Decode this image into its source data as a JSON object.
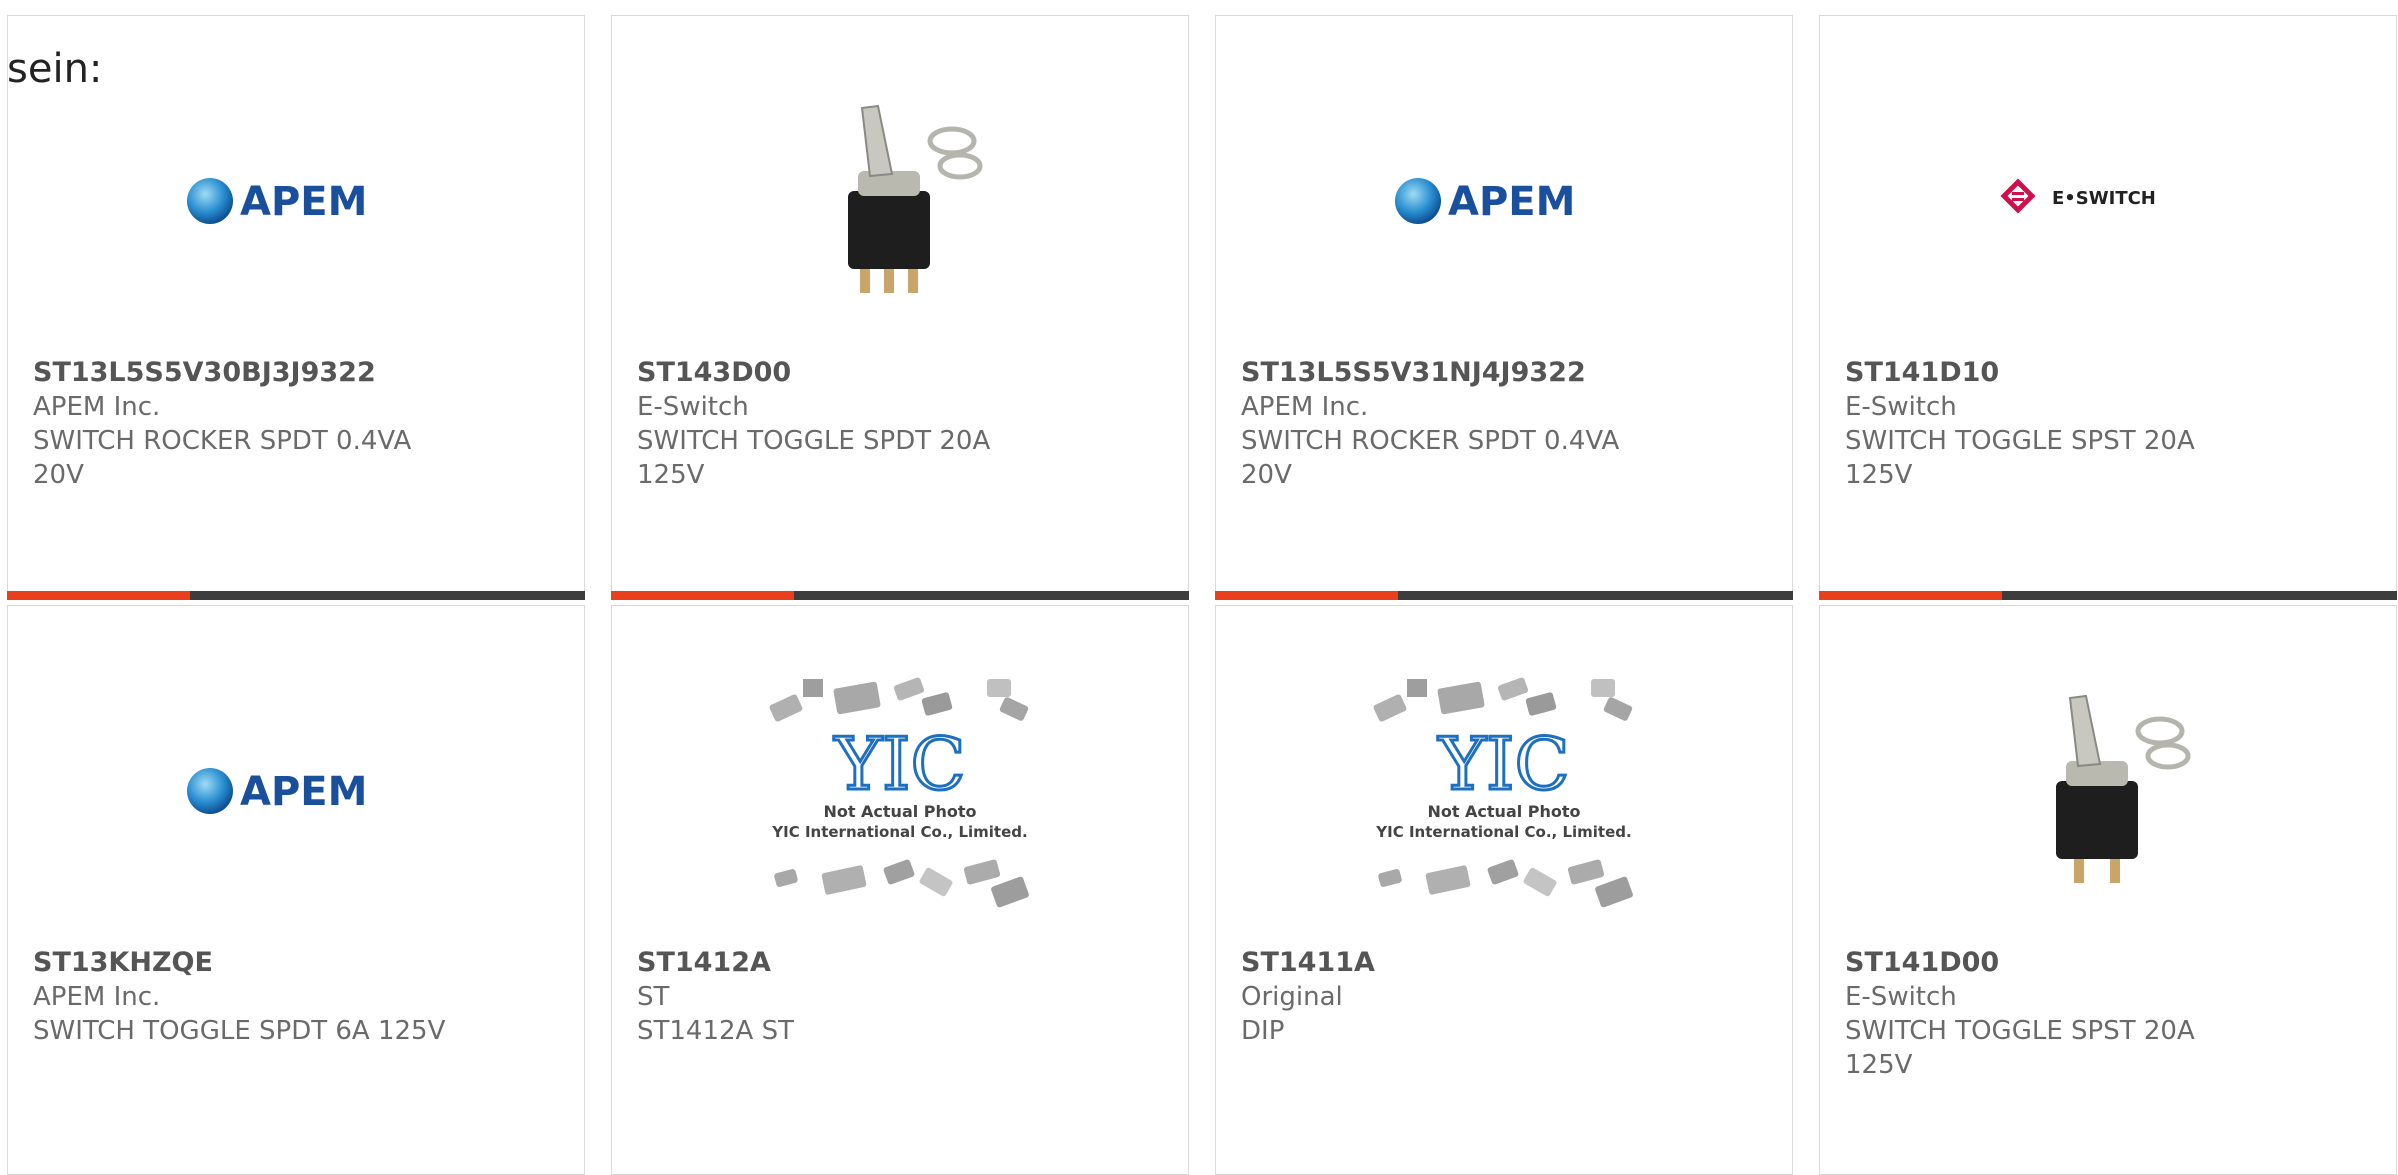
{
  "header": {
    "label": "sein:"
  },
  "colors": {
    "accent": "#e8401c",
    "bar": "#3d3d3d",
    "apem_blue": "#1a4f9c",
    "eswitch_red": "#d0104c"
  },
  "products": [
    {
      "part": "ST13L5S5V30BJ3J9322",
      "manufacturer": "APEM Inc.",
      "description": "SWITCH ROCKER SPDT 0.4VA 20V",
      "image": "apem-logo",
      "logo_text": "APEM"
    },
    {
      "part": "ST143D00",
      "manufacturer": "E-Switch",
      "description": "SWITCH TOGGLE SPDT 20A 125V",
      "image": "toggle-switch-photo"
    },
    {
      "part": "ST13L5S5V31NJ4J9322",
      "manufacturer": "APEM Inc.",
      "description": "SWITCH ROCKER SPDT 0.4VA 20V",
      "image": "apem-logo",
      "logo_text": "APEM"
    },
    {
      "part": "ST141D10",
      "manufacturer": "E-Switch",
      "description": "SWITCH TOGGLE SPST 20A 125V",
      "image": "eswitch-logo",
      "logo_text": "E•SWITCH"
    },
    {
      "part": "ST13KHZQE",
      "manufacturer": "APEM Inc.",
      "description": "SWITCH TOGGLE SPDT 6A 125V",
      "image": "apem-logo",
      "logo_text": "APEM"
    },
    {
      "part": "ST1412A",
      "manufacturer": "ST",
      "description": "ST1412A ST",
      "image": "yic-placeholder",
      "logo_text": "YIC",
      "caption1": "Not Actual Photo",
      "caption2": "YIC International Co., Limited."
    },
    {
      "part": "ST1411A",
      "manufacturer": "Original",
      "description": "DIP",
      "image": "yic-placeholder",
      "logo_text": "YIC",
      "caption1": "Not Actual Photo",
      "caption2": "YIC International Co., Limited."
    },
    {
      "part": "ST141D00",
      "manufacturer": "E-Switch",
      "description": "SWITCH TOGGLE SPST 20A 125V",
      "image": "toggle-switch-photo"
    }
  ]
}
